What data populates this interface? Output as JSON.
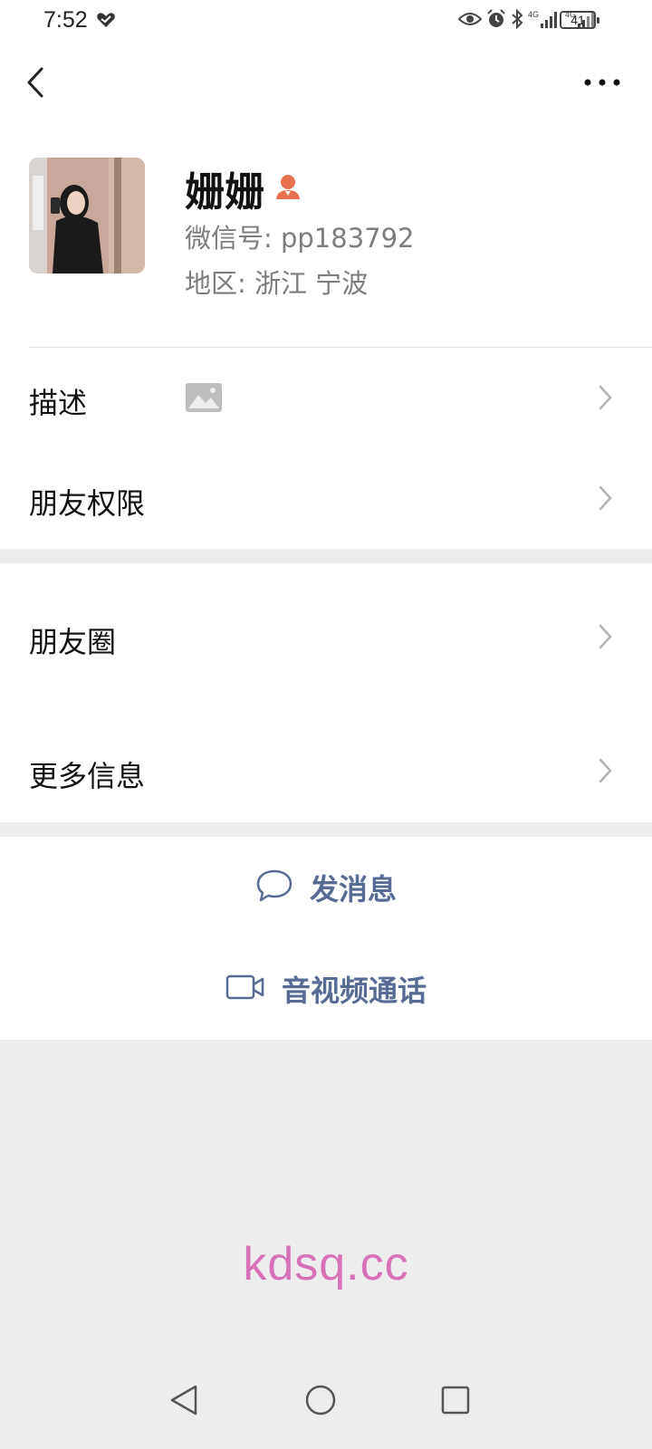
{
  "status_bar": {
    "time": "7:52",
    "battery": "41",
    "icons": [
      "heart-check-icon",
      "eye-icon",
      "alarm-icon",
      "bluetooth-icon",
      "signal-4g-icon",
      "signal-4g-icon"
    ]
  },
  "nav": {
    "back_icon": "chevron-left-icon",
    "more_icon": "more-dots-icon"
  },
  "profile": {
    "name": "姗姗",
    "wechat_id": "微信号:  pp183792",
    "region": "地区:  浙江  宁波"
  },
  "rows": {
    "description": "描述",
    "friend_permissions": "朋友权限",
    "moments": "朋友圈",
    "more_info": "更多信息"
  },
  "actions": {
    "send_message": "发消息",
    "av_call": "音视频通话"
  },
  "watermark": "kdsq.cc",
  "colors": {
    "accent": "#576b95",
    "contact_badge": "#e8704c",
    "watermark": "#d672b5",
    "page_bg": "#ededed"
  }
}
